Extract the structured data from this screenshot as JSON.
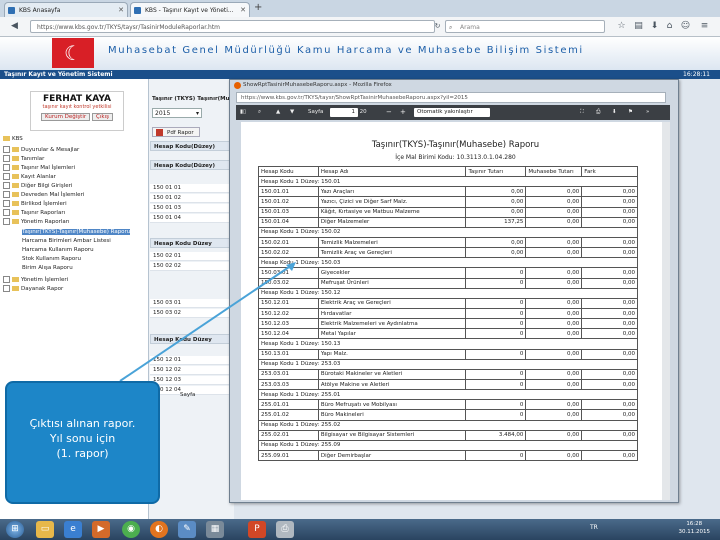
{
  "browser": {
    "tabs": [
      {
        "label": "KBS Anasayfa"
      },
      {
        "label": "KBS - Taşınır Kayıt ve Yöneti..."
      }
    ],
    "url": "https://www.kbs.gov.tr/TKYS/taysr/TasinirModuleRaporlar.htm",
    "search_placeholder": "Arama"
  },
  "site": {
    "title": "Muhasebat Genel Müdürlüğü Kamu Harcama ve Muhasebe Bilişim Sistemi",
    "app_name": "Taşınır Kayıt ve Yönetim Sistemi",
    "clock": "16:28:11"
  },
  "user": {
    "name": "FERHAT KAYA",
    "role": "taşınır kayıt kontrol yetkilisi",
    "change_password": "Kurum Değiştir",
    "logout": "Çıkış"
  },
  "tree": [
    {
      "label": "KBS"
    },
    {
      "label": "Duyurular & Mesajlar"
    },
    {
      "label": "Tanımlar"
    },
    {
      "label": "Taşınır Mal İşlemleri"
    },
    {
      "label": "Kayıt Alanlar"
    },
    {
      "label": "Diğer Bilgi Girişleri"
    },
    {
      "label": "Devreden Mal İşlemleri"
    },
    {
      "label": "Birlikod İşlemleri"
    },
    {
      "label": "Taşınır Raporları"
    },
    {
      "label": "Yönetim Raporları"
    },
    {
      "label": "Taşınır(TKYS)-Taşınır(Muhasebe) Raporu"
    },
    {
      "label": "Harcama Birimleri Ambar Listesi"
    },
    {
      "label": "Harcama Kullanım Raporu"
    },
    {
      "label": "Stok Kullanım Raporu"
    },
    {
      "label": "Birim Alışa Raporu"
    },
    {
      "label": "Yönetim İşlemleri"
    },
    {
      "label": "Dayanak Rapor"
    }
  ],
  "mid": {
    "header_tabs": "Taşınır (TKYS)  Taşınır(Mu...",
    "year": "2015",
    "pdf_button": "Pdf Rapor",
    "col1_header": "Hesap Kodu(Düzey)",
    "rows_a": [
      "150 01 01",
      "150 01 02",
      "150 01 03",
      "150 01 04"
    ],
    "col2_header": "Hesap Kodu Düzey",
    "rows_b": [
      "150 02 01",
      "150 02 02"
    ],
    "rows_c": [
      "150 03 01",
      "150 03 02"
    ],
    "col3_header": "Hesap Kodu Düzey",
    "rows_d": [
      "150 12 01",
      "150 12 02",
      "150 12 03",
      "150 12 04"
    ],
    "pager": "Sayfa"
  },
  "popup": {
    "title": "ShowRptTasinirMuhasebeRaporu.aspx - Mozilla Firefox",
    "url": "https://www.kbs.gov.tr/TKYS/taysr/ShowRptTasinirMuhasebeRaporu.aspx?yil=2015",
    "page_label": "Sayfa",
    "page_number": "1",
    "page_total": "/ 20",
    "zoom": "Otomatik yakınlaştır"
  },
  "report": {
    "title": "Taşınır(TKYS)-Taşınır(Muhasebe) Raporu",
    "subtitle": "İçe Mal Birimi Kodu: 10.3113.0.1.04.280",
    "columns": [
      "Hesap Kodu",
      "Hesap Adı",
      "Taşınır Tutarı",
      "Muhasebe Tutarı",
      "Fark"
    ],
    "rows": [
      {
        "type": "grp",
        "text": "Hesap Kodu 1 Düzey: 150.01"
      },
      {
        "type": "row",
        "code": "150.01.01",
        "name": "Yazı Araçları",
        "a": "0,00",
        "b": "0,00",
        "c": "0,00"
      },
      {
        "type": "row",
        "code": "150.01.02",
        "name": "Yazıcı, Çizici ve Diğer Sarf Malz.",
        "a": "0,00",
        "b": "0,00",
        "c": "0,00"
      },
      {
        "type": "row",
        "code": "150.01.03",
        "name": "Kâğıt, Kırtasiye ve Matbuu Malzeme",
        "a": "0,00",
        "b": "0,00",
        "c": "0,00"
      },
      {
        "type": "row",
        "code": "150.01.04",
        "name": "Diğer Malzemeler",
        "a": "137,25",
        "b": "0,00",
        "c": "0,00"
      },
      {
        "type": "grp",
        "text": "Hesap Kodu 1 Düzey: 150.02"
      },
      {
        "type": "row",
        "code": "150.02.01",
        "name": "Temizlik Malzemeleri",
        "a": "0,00",
        "b": "0,00",
        "c": "0,00"
      },
      {
        "type": "row",
        "code": "150.02.02",
        "name": "Temizlik Araç ve Gereçleri",
        "a": "0,00",
        "b": "0,00",
        "c": "0,00"
      },
      {
        "type": "grp",
        "text": "Hesap Kodu 1 Düzey: 150.03"
      },
      {
        "type": "row",
        "code": "150.03.01",
        "name": "Giyecekler",
        "a": "0",
        "b": "0,00",
        "c": "0,00"
      },
      {
        "type": "row",
        "code": "150.03.02",
        "name": "Mefruşat Ürünleri",
        "a": "0",
        "b": "0,00",
        "c": "0,00"
      },
      {
        "type": "grp",
        "text": "Hesap Kodu 1 Düzey: 150.12"
      },
      {
        "type": "row",
        "code": "150.12.01",
        "name": "Elektrik Araç ve Gereçleri",
        "a": "0",
        "b": "0,00",
        "c": "0,00"
      },
      {
        "type": "row",
        "code": "150.12.02",
        "name": "Hırdavatlar",
        "a": "0",
        "b": "0,00",
        "c": "0,00"
      },
      {
        "type": "row",
        "code": "150.12.03",
        "name": "Elektrik Malzemeleri ve Aydınlatma",
        "a": "0",
        "b": "0,00",
        "c": "0,00"
      },
      {
        "type": "row",
        "code": "150.12.04",
        "name": "Metal Yapılar",
        "a": "0",
        "b": "0,00",
        "c": "0,00"
      },
      {
        "type": "grp",
        "text": "Hesap Kodu 1 Düzey: 150.13"
      },
      {
        "type": "row",
        "code": "150.13.01",
        "name": "Yapı Malz.",
        "a": "0",
        "b": "0,00",
        "c": "0,00"
      },
      {
        "type": "grp",
        "text": "Hesap Kodu 1 Düzey: 253.03"
      },
      {
        "type": "row",
        "code": "253.03.01",
        "name": "Bürotaki Makineler ve Aletleri",
        "a": "0",
        "b": "0,00",
        "c": "0,00"
      },
      {
        "type": "row",
        "code": "253.03.03",
        "name": "Atölye Makine ve Aletleri",
        "a": "0",
        "b": "0,00",
        "c": "0,00"
      },
      {
        "type": "grp",
        "text": "Hesap Kodu 1 Düzey: 255.01"
      },
      {
        "type": "row",
        "code": "255.01.01",
        "name": "Büro Mefruşatı ve Mobilyası",
        "a": "0",
        "b": "0,00",
        "c": "0,00"
      },
      {
        "type": "row",
        "code": "255.01.02",
        "name": "Büro Makineleri",
        "a": "0",
        "b": "0,00",
        "c": "0,00"
      },
      {
        "type": "grp",
        "text": "Hesap Kodu 1 Düzey: 255.02"
      },
      {
        "type": "row",
        "code": "255.02.01",
        "name": "Bilgisayar ve Bilgisayar Sistemleri",
        "a": "3.484,00",
        "b": "0,00",
        "c": "0,00"
      },
      {
        "type": "grp",
        "text": "Hesap Kodu 1 Düzey: 255.09"
      },
      {
        "type": "row",
        "code": "255.09.01",
        "name": "Diğer Demirbaşlar",
        "a": "0",
        "b": "0,00",
        "c": "0,00"
      }
    ]
  },
  "callout": {
    "line1": "Çıktısı alınan rapor.",
    "line2": "Yıl sonu için",
    "line3": "(1. rapor)"
  },
  "taskbar": {
    "apps": [
      "start",
      "explorer",
      "ie",
      "media",
      "chrome",
      "firefox",
      "paint",
      "calc",
      "powerpoint",
      "pdf"
    ],
    "tray_label": "TR",
    "time": "16:28",
    "date": "30.11.2015"
  },
  "colors": {
    "brand_blue": "#1b4f8a",
    "callout_blue": "#1d86c8",
    "flag_red": "#d81f26"
  }
}
